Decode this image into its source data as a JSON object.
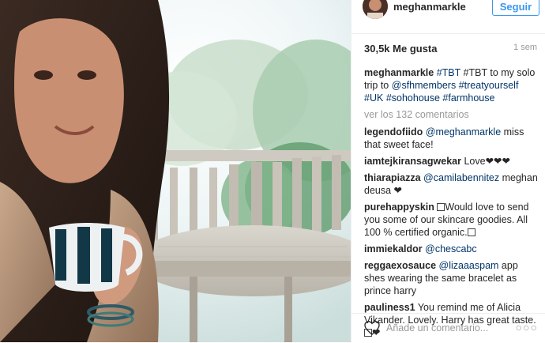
{
  "header": {
    "username": "meghanmarkle",
    "follow_label": "Seguir"
  },
  "stats": {
    "likes": "30,5k Me gusta",
    "age": "1 sem"
  },
  "caption": {
    "user": "meghanmarkle",
    "parts": [
      " #TBT to my solo trip to ",
      "@sfhmembers",
      " ",
      "#treatyourself",
      " ",
      "#UK",
      " ",
      "#sohohouse",
      " ",
      "#farmhouse"
    ],
    "first_tag": "#TBT"
  },
  "view_all": "ver los 132 comentarios",
  "comments": [
    {
      "user": "legendofiido",
      "mention": "@meghanmarkle",
      "text": " miss that sweet face!"
    },
    {
      "user": "iamtejkiransagwekar",
      "text": " Love❤❤❤"
    },
    {
      "user": "thiarapiazza",
      "mention": "@camilabennitez",
      "text": " meghan deusa ❤"
    },
    {
      "user": "purehappyskin",
      "text": "Would love to send you some of our skincare goodies. All 100 % certified organic."
    },
    {
      "user": "immiekaldor",
      "mention": "@chescabc",
      "text": ""
    },
    {
      "user": "reggaexosauce",
      "mention": "@lizaaaspam",
      "text": " app shes wearing the same bracelet as prince harry"
    },
    {
      "user": "pauliness1",
      "text": " You remind me of Alicia Vikander. Lovely. Harry has great taste."
    },
    {
      "tail": "❤"
    }
  ],
  "footer": {
    "add_comment_placeholder": "Añade un comentario...",
    "icons": [
      "heart-icon",
      "more-options-icon"
    ]
  },
  "colors": {
    "accent": "#3897f0",
    "link": "#003569",
    "muted": "#999999",
    "text": "#262626"
  }
}
